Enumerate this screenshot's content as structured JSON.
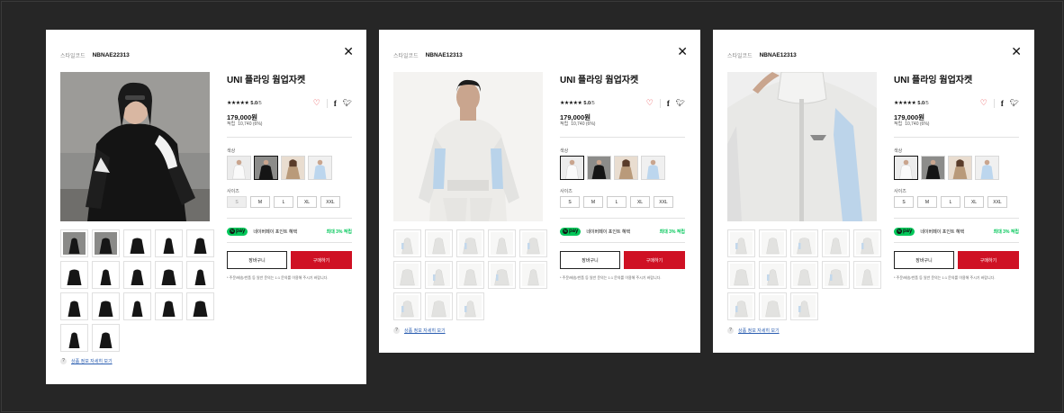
{
  "common": {
    "style_label": "스타일코드",
    "title": "UNI 플라잉 웜업자켓",
    "stars": "★★★★★",
    "score": "5.0",
    "score_max": "/5",
    "price": "179,000원",
    "point_label": "적립",
    "point_value": "10,740 (6%)",
    "color_label": "색상",
    "size_label": "사이즈",
    "sizes": [
      "S",
      "M",
      "L",
      "XL",
      "XXL"
    ],
    "npay_logo": "pay",
    "npay_text": "네이버페이 포인트 혜택",
    "npay_max": "최대 3% 적립",
    "cart_label": "장바구니",
    "buy_label": "구매하기",
    "note": "* 주문/배송/반품 등 일반 문의는 1:1 문의를 이용해 주시기 바랍니다.",
    "detail_link": "상품 정보 자세히 보기",
    "icons": {
      "close": "close-icon",
      "heart": "heart-icon",
      "facebook": "facebook-icon",
      "twitter": "twitter-icon",
      "help": "help-icon"
    },
    "colors": {
      "buy": "#cf1124",
      "npay": "#03c75a",
      "heart": "#e5252a",
      "link": "#2a5db0"
    }
  },
  "panels": [
    {
      "style_code": "NBNAE22313",
      "selected_color_index": 1,
      "disabled_size_index": 0,
      "thumbnail_count": 17,
      "variant": "black"
    },
    {
      "style_code": "NBNAE12313",
      "selected_color_index": 0,
      "disabled_size_index": -1,
      "thumbnail_count": 13,
      "variant": "white-model"
    },
    {
      "style_code": "NBNAE12313",
      "selected_color_index": 0,
      "disabled_size_index": -1,
      "thumbnail_count": 13,
      "variant": "white-closeup"
    }
  ]
}
